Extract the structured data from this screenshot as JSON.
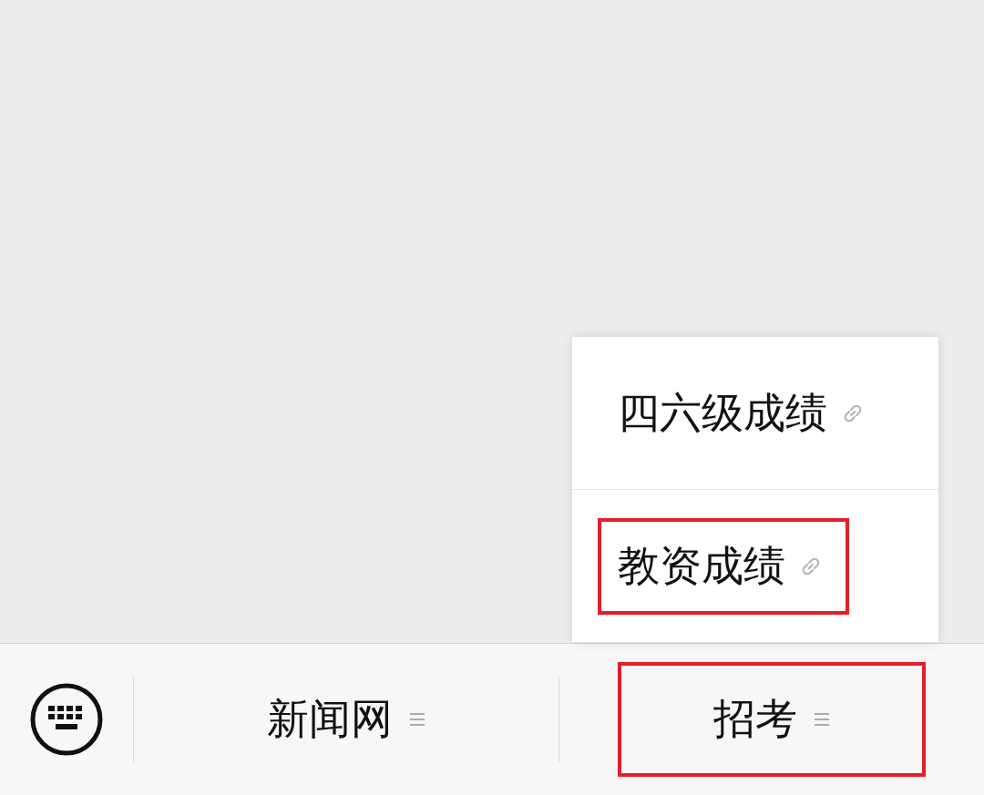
{
  "popup_menu": {
    "items": [
      {
        "label": "四六级成绩",
        "highlighted": false
      },
      {
        "label": "教资成绩",
        "highlighted": true
      }
    ]
  },
  "bottom_menu": {
    "items": [
      {
        "label": "新闻网",
        "highlighted": false
      },
      {
        "label": "招考",
        "highlighted": true
      }
    ]
  }
}
